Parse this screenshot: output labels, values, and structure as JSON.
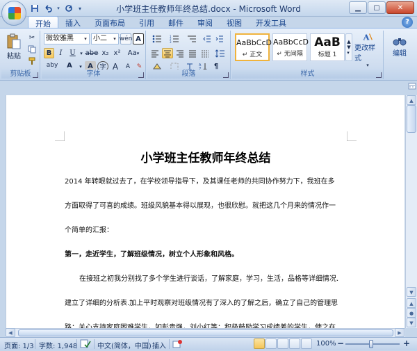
{
  "window": {
    "title": "小学班主任教师年终总结.docx - Microsoft Word"
  },
  "qat": {
    "save_icon": "save-icon",
    "undo_icon": "undo-icon",
    "redo_icon": "redo-icon"
  },
  "tabs": [
    {
      "label": "开始",
      "active": true
    },
    {
      "label": "插入"
    },
    {
      "label": "页面布局"
    },
    {
      "label": "引用"
    },
    {
      "label": "邮件"
    },
    {
      "label": "审阅"
    },
    {
      "label": "视图"
    },
    {
      "label": "开发工具"
    }
  ],
  "ribbon": {
    "clipboard": {
      "label": "剪贴板",
      "paste": "粘贴"
    },
    "font": {
      "label": "字体",
      "font_name": "微软雅黑",
      "font_size": "小二",
      "bold": "B",
      "italic": "I",
      "underline": "U",
      "strike": "abe",
      "sub": "x₂",
      "sup": "x²",
      "clear": "Aa",
      "phonetic": "wén",
      "char_border": "A",
      "grow": "A",
      "shrink": "A",
      "case": "Aa",
      "highlight": "aby",
      "color": "A",
      "shade": "A",
      "enclose": "字"
    },
    "paragraph": {
      "label": "段落"
    },
    "styles": {
      "label": "样式",
      "items": [
        {
          "sample": "AaBbCcD",
          "name": "↵ 正文",
          "selected": true
        },
        {
          "sample": "AaBbCcD",
          "name": "↵ 无间隔"
        },
        {
          "sample": "AaB",
          "name": "标题 1"
        }
      ],
      "change": "更改样式"
    },
    "editing": {
      "label": "编辑"
    }
  },
  "document": {
    "title": "小学班主任教师年终总结",
    "paragraphs": [
      "2014 年转眼就过去了，在学校领导指导下，及其课任老师的共同协作努力下，我班在多",
      "方面取得了可喜的成绩。班级风貌基本得以展现，也很欣慰。就把这几个月来的情况作一",
      "个简单的汇报：",
      "第一，走近学生，了解班级情况，树立个人形象和风格。",
      "在接班之初我分别找了多个学生进行谈话，了解家庭，学习，生活，品格等详细情况.",
      "建立了详细的分析表.加上平时观察对班级情况有了深入的了解之后，确立了自己的管理思",
      "路：关心支持家庭困难学生，如彭贵强，刘小红等；积极鼓励学习成绩差的学生，使之在"
    ]
  },
  "status": {
    "page": "页面: 1/3",
    "words": "字数: 1,948",
    "lang": "中文(简体，中国)",
    "mode": "插入",
    "zoom": "100%",
    "zoom_minus": "−",
    "zoom_plus": "+"
  }
}
